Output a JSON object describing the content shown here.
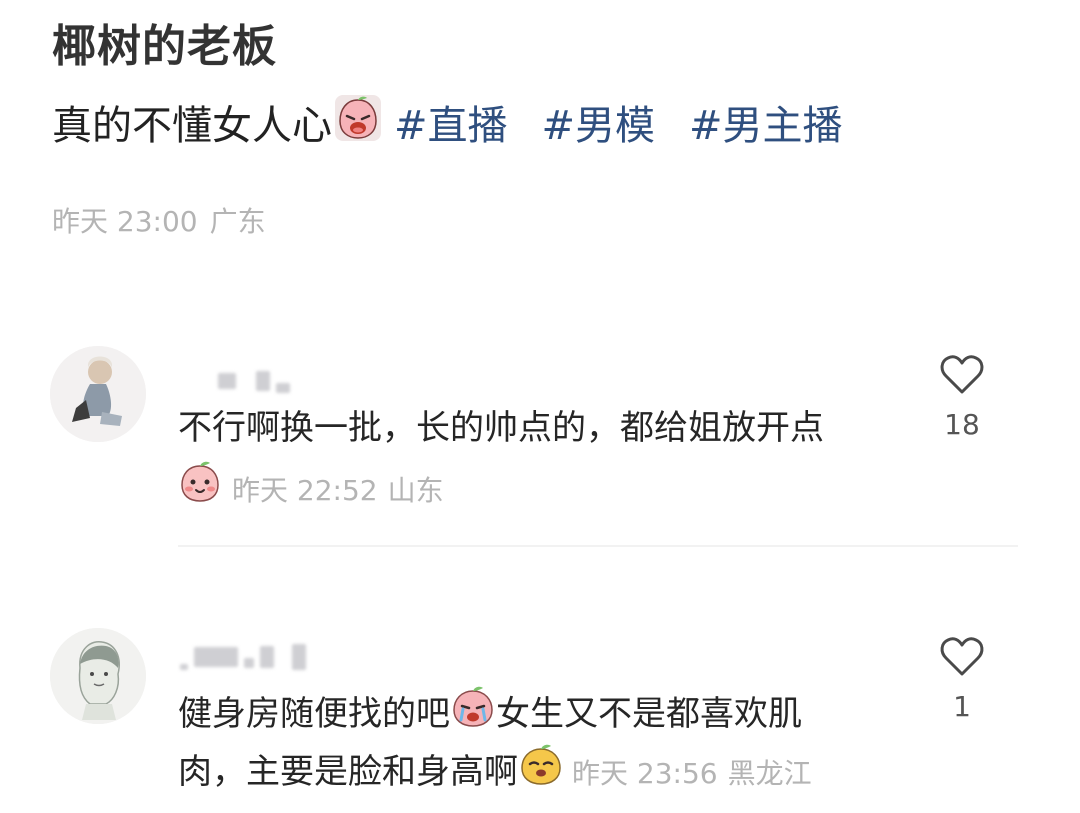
{
  "post": {
    "author": "椰树的老板",
    "text": "真的不懂女人心",
    "emoji": "crying-face-emoji",
    "tags": [
      "#直播",
      "#男模",
      "#男主播"
    ],
    "date": "昨天 23:00",
    "location": "广东"
  },
  "comments": [
    {
      "text": "不行啊换一批，长的帅点的，都给姐放开点",
      "emoji": "blushing-peach-emoji",
      "date": "昨天 22:52",
      "location": "山东",
      "likes": "18"
    },
    {
      "text_line1_a": "健身房随便找的吧",
      "text_line1_b": "女生又不是都喜欢肌",
      "text_line2": "肉，主要是脸和身高啊",
      "emoji_inline": "crying-peach-emoji",
      "emoji_end": "smug-peach-emoji",
      "date": "昨天 23:56",
      "location": "黑龙江",
      "likes": "1"
    }
  ],
  "colors": {
    "tag": "#2f4f7f",
    "meta": "#b4b4b4",
    "text": "#262626",
    "emoji_pink": "#f6b3b8",
    "emoji_yellow": "#f5c74a",
    "leaf_green": "#7cc36b"
  }
}
